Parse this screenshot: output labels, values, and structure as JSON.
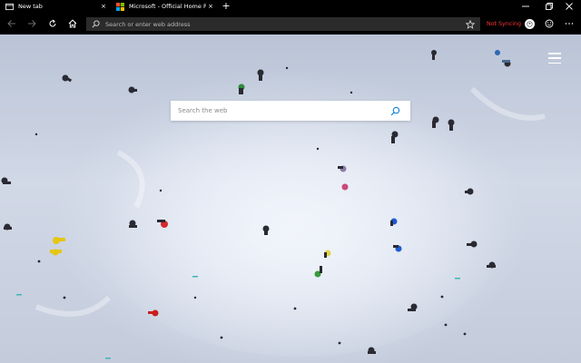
{
  "tabs": [
    {
      "title": "New tab",
      "active": true,
      "close_glyph": "×"
    },
    {
      "title": "Microsoft - Official Home Page",
      "active": false,
      "close_glyph": "×",
      "favicon": "microsoft-logo-icon"
    }
  ],
  "new_tab_glyph": "+",
  "window_controls": [
    "minimize-icon",
    "restore-icon",
    "close-icon"
  ],
  "toolbar": {
    "back_icon": "back-arrow-icon",
    "forward_icon": "forward-arrow-icon",
    "refresh_icon": "refresh-icon",
    "home_icon": "home-icon",
    "address_placeholder": "Search or enter web address",
    "favorite_icon": "star-icon",
    "sync_status": "Not Syncing",
    "sync_status_color": "#ff3434",
    "feedback_icon": "smiley-icon",
    "more_icon": "ellipsis-icon"
  },
  "content": {
    "search_placeholder": "Search the web",
    "search_icon": "search-icon",
    "accent_color": "#0078d7",
    "menu_icon": "hamburger-menu-icon"
  }
}
